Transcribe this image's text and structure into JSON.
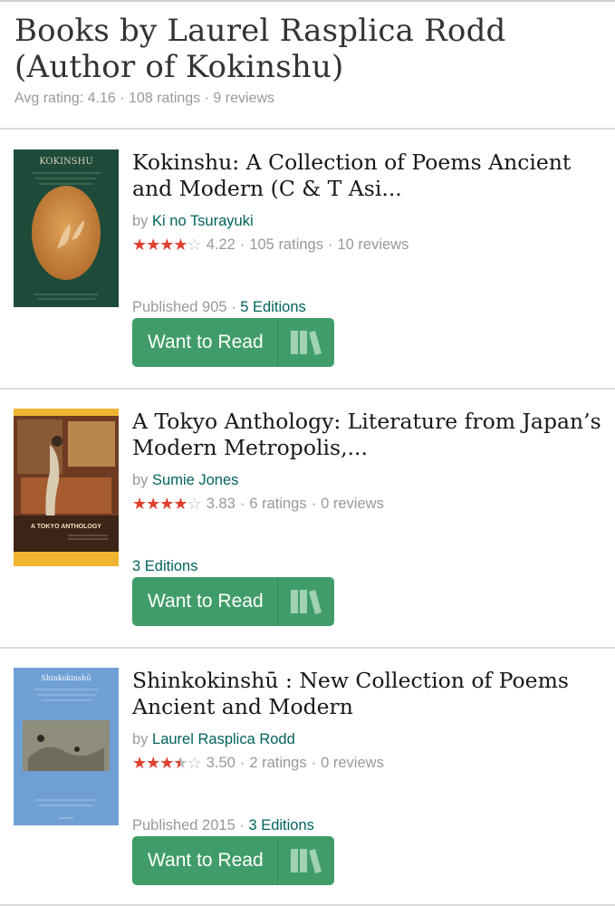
{
  "page": {
    "title": "Books by Laurel Rasplica Rodd (Author of Kokinshu)",
    "avg_rating": "Avg rating: 4.16",
    "ratings": "108 ratings",
    "reviews": "9 reviews",
    "sep": "·"
  },
  "books": [
    {
      "title": "Kokinshu: A Collection of Poems Ancient and Modern (C & T Asi...",
      "by_prefix": "by",
      "author": "Ki no Tsurayuki",
      "rating_value": 4.22,
      "rating": "4.22",
      "ratings": "105 ratings",
      "reviews": "10 reviews",
      "published": "Published 905",
      "editions": "5 Editions",
      "button": "Want to Read",
      "cover_text": "KOKINSHU"
    },
    {
      "title": "A Tokyo Anthology: Literature from Japan’s Modern Metropolis,...",
      "by_prefix": "by",
      "author": "Sumie Jones",
      "rating_value": 3.83,
      "rating": "3.83",
      "ratings": "6 ratings",
      "reviews": "0 reviews",
      "published": "",
      "editions": "3 Editions",
      "button": "Want to Read",
      "cover_text": "A TOKYO ANTHOLOGY"
    },
    {
      "title": "Shinkokinshū : New Collection of Poems Ancient and Modern",
      "by_prefix": "by",
      "author": "Laurel Rasplica Rodd",
      "rating_value": 3.5,
      "rating": "3.50",
      "ratings": "2 ratings",
      "reviews": "0 reviews",
      "published": "Published 2015",
      "editions": "3 Editions",
      "button": "Want to Read",
      "cover_text": "Shinkokinshū"
    }
  ],
  "icons": {
    "shelf": "bookshelf-icon",
    "star": "star-icon"
  },
  "colors": {
    "accent_green": "#409d69",
    "link": "#00635d",
    "star": "#e0402f"
  }
}
